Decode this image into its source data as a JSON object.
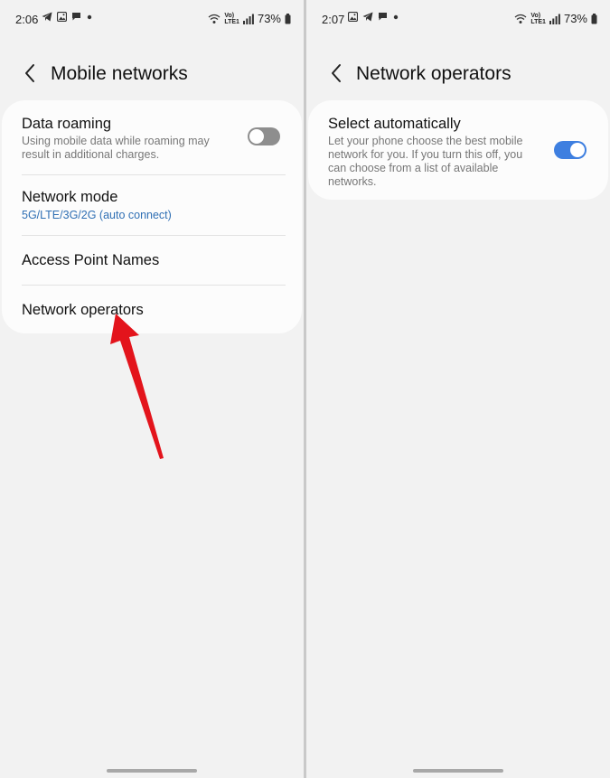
{
  "left": {
    "status": {
      "time": "2:06",
      "volte": "Vo)",
      "lte": "LTE1",
      "battery": "73%"
    },
    "header": {
      "title": "Mobile networks"
    },
    "items": {
      "data_roaming": {
        "label": "Data roaming",
        "description": "Using mobile data while roaming may result in additional charges.",
        "enabled": false
      },
      "network_mode": {
        "label": "Network mode",
        "value": "5G/LTE/3G/2G (auto connect)"
      },
      "apn": {
        "label": "Access Point Names"
      },
      "operators": {
        "label": "Network operators"
      }
    }
  },
  "right": {
    "status": {
      "time": "2:07",
      "volte": "Vo)",
      "lte": "LTE1",
      "battery": "73%"
    },
    "header": {
      "title": "Network operators"
    },
    "items": {
      "select_auto": {
        "label": "Select automatically",
        "description": "Let your phone choose the best mobile network for you. If you turn this off, you can choose from a list of available networks.",
        "enabled": true
      }
    }
  },
  "colors": {
    "accent": "#3e7fe0",
    "link": "#2f6fb4",
    "annotation": "#e3141c"
  }
}
